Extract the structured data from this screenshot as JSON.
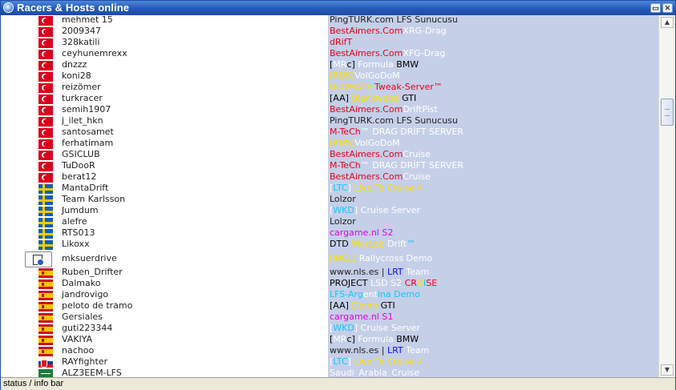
{
  "window": {
    "title": "Racers & Hosts online"
  },
  "rows": [
    {
      "flag": "tr",
      "racer": "mehmet 15",
      "host": [
        [
          "PingTURK.com LFS Sunucusu",
          "#222222"
        ]
      ]
    },
    {
      "flag": "tr",
      "racer": "2009347",
      "host": [
        [
          "BestAimers.Com",
          "#e8001c"
        ],
        [
          "XRG-Drag",
          "#ffffff"
        ]
      ]
    },
    {
      "flag": "tr",
      "racer": "328katili",
      "host": [
        [
          "dRifT",
          "#e8001c"
        ]
      ]
    },
    {
      "flag": "tr",
      "racer": "ceyhunemrexx",
      "host": [
        [
          "BestAimers.Com",
          "#e8001c"
        ],
        [
          "XFG-Drag",
          "#ffffff"
        ]
      ]
    },
    {
      "flag": "tr",
      "racer": "dnzzz",
      "host": [
        [
          "[",
          "#000000"
        ],
        [
          "MR",
          "#ffffff"
        ],
        [
          "c] ",
          "#000000"
        ],
        [
          "Formula ",
          "#ffffff"
        ],
        [
          "BMW",
          "#000000"
        ]
      ]
    },
    {
      "flag": "tr",
      "racer": "koni28",
      "host": [
        [
          "[RUS]",
          "#ffe000"
        ],
        [
          "VolGoDoM",
          "#ffffff"
        ]
      ]
    },
    {
      "flag": "tr",
      "racer": "reizömer",
      "host": [
        [
          "ULTIMATE ",
          "#ffe000"
        ],
        [
          "Tweak-Server™",
          "#e8001c"
        ]
      ]
    },
    {
      "flag": "tr",
      "racer": "turkracer",
      "host": [
        [
          "[AA] ",
          "#000000"
        ],
        [
          "Blackwood ",
          "#ffe000"
        ],
        [
          "GTI",
          "#000000"
        ]
      ]
    },
    {
      "flag": "tr",
      "racer": "semih1907",
      "host": [
        [
          "BestAimers.Com",
          "#e8001c"
        ],
        [
          "DriftPist",
          "#ffffff"
        ]
      ]
    },
    {
      "flag": "tr",
      "racer": "j_ilet_hkn",
      "host": [
        [
          "PingTURK.com LFS Sunucusu",
          "#222222"
        ]
      ]
    },
    {
      "flag": "tr",
      "racer": "santosamet",
      "host": [
        [
          "M-TeCh",
          "#e8001c"
        ],
        [
          "™ DRAG DRİFT SERVER",
          "#ffffff"
        ]
      ]
    },
    {
      "flag": "tr",
      "racer": "ferhatimam",
      "host": [
        [
          "[RUS]",
          "#ffe000"
        ],
        [
          "VolGoDoM",
          "#ffffff"
        ]
      ]
    },
    {
      "flag": "tr",
      "racer": "GSICLUB",
      "host": [
        [
          "BestAimers.Com",
          "#e8001c"
        ],
        [
          "Cruise",
          "#ffffff"
        ]
      ]
    },
    {
      "flag": "tr",
      "racer": "TuDooR",
      "host": [
        [
          "M-TeCh",
          "#e8001c"
        ],
        [
          "™ DRAG DRİFT SERVER",
          "#ffffff"
        ]
      ]
    },
    {
      "flag": "tr",
      "racer": "berat12",
      "host": [
        [
          "BestAimers.Com",
          "#e8001c"
        ],
        [
          "Cruise",
          "#ffffff"
        ]
      ]
    },
    {
      "flag": "se",
      "racer": "MantaDrift",
      "host": [
        [
          "[",
          "#ffffff"
        ],
        [
          "LTC",
          "#10c8ff"
        ],
        [
          "] ",
          "#ffffff"
        ],
        [
          "Live To Cruise 4",
          "#ffe000"
        ]
      ]
    },
    {
      "flag": "se",
      "racer": "Team Karlsson",
      "host": [
        [
          "Lolzor",
          "#222222"
        ]
      ]
    },
    {
      "flag": "se",
      "racer": "Jumdum",
      "host": [
        [
          "[",
          "#ffffff"
        ],
        [
          "WKD",
          "#10c8ff"
        ],
        [
          "] Cruise Server",
          "#ffffff"
        ]
      ]
    },
    {
      "flag": "se",
      "racer": "alefre",
      "host": [
        [
          "Lolzor",
          "#222222"
        ]
      ]
    },
    {
      "flag": "se",
      "racer": "RTS013",
      "host": [
        [
          "cargame.nl S2",
          "#e000e0"
        ]
      ]
    },
    {
      "flag": "se",
      "racer": "Likoxx",
      "host": [
        [
          "DTD ",
          "#000000"
        ],
        [
          "WarLab",
          "#ffe000"
        ],
        [
          " Drift",
          "#ffffff"
        ],
        [
          "™",
          "#10c8ff"
        ]
      ]
    },
    {
      "flag": "special",
      "racer": "mksuerdrive",
      "host": [
        [
          "[WCL] ",
          "#ffe000"
        ],
        [
          "Rallycross Demo",
          "#ffffff"
        ]
      ]
    },
    {
      "flag": "es",
      "racer": "Ruben_Drifter",
      "host": [
        [
          "www.nls.es | ",
          "#222222"
        ],
        [
          "LRT",
          "#1010ff"
        ],
        [
          " Team",
          "#ffffff"
        ]
      ]
    },
    {
      "flag": "es",
      "racer": "Dalmako",
      "host": [
        [
          "PROJECT ",
          "#000000"
        ],
        [
          "LSD S2 ",
          "#ffffff"
        ],
        [
          "CR",
          "#e8001c"
        ],
        [
          "U",
          "#ffe000"
        ],
        [
          "I",
          "#10c8ff"
        ],
        [
          "SE",
          "#e8001c"
        ]
      ]
    },
    {
      "flag": "es",
      "racer": "jandrovigo",
      "host": [
        [
          "LFS-Arg",
          "#10c8ff"
        ],
        [
          "ent",
          "#ffffff"
        ],
        [
          "ina Demo",
          "#10c8ff"
        ]
      ]
    },
    {
      "flag": "es",
      "racer": "peloto de tramo",
      "host": [
        [
          "[AA] ",
          "#000000"
        ],
        [
          "Demo ",
          "#ffe000"
        ],
        [
          "GTI",
          "#000000"
        ]
      ]
    },
    {
      "flag": "es",
      "racer": "Gersiales",
      "host": [
        [
          "cargame.nl S1",
          "#e000e0"
        ]
      ]
    },
    {
      "flag": "es",
      "racer": "guti223344",
      "host": [
        [
          "[",
          "#ffffff"
        ],
        [
          "WKD",
          "#10c8ff"
        ],
        [
          "] Cruise Server",
          "#ffffff"
        ]
      ]
    },
    {
      "flag": "es",
      "racer": "VAKIYA",
      "host": [
        [
          "[",
          "#000000"
        ],
        [
          "MR",
          "#ffffff"
        ],
        [
          "c] ",
          "#000000"
        ],
        [
          "Formula ",
          "#ffffff"
        ],
        [
          "BMW",
          "#000000"
        ]
      ]
    },
    {
      "flag": "es",
      "racer": "nachoo",
      "host": [
        [
          "www.nls.es | ",
          "#222222"
        ],
        [
          "LRT",
          "#1010ff"
        ],
        [
          " Team",
          "#ffffff"
        ]
      ]
    },
    {
      "flag": "sk",
      "racer": "RAYfighter",
      "host": [
        [
          "[",
          "#ffffff"
        ],
        [
          "LTC",
          "#10c8ff"
        ],
        [
          "] ",
          "#ffffff"
        ],
        [
          "Live To Cruise 4",
          "#ffe000"
        ]
      ]
    },
    {
      "flag": "sa",
      "racer": "ALZ3EEM-LFS",
      "host": [
        [
          "Saudi_Arabia_Cruise",
          "#ffffff"
        ]
      ]
    }
  ],
  "status": {
    "text": "status / info bar"
  }
}
